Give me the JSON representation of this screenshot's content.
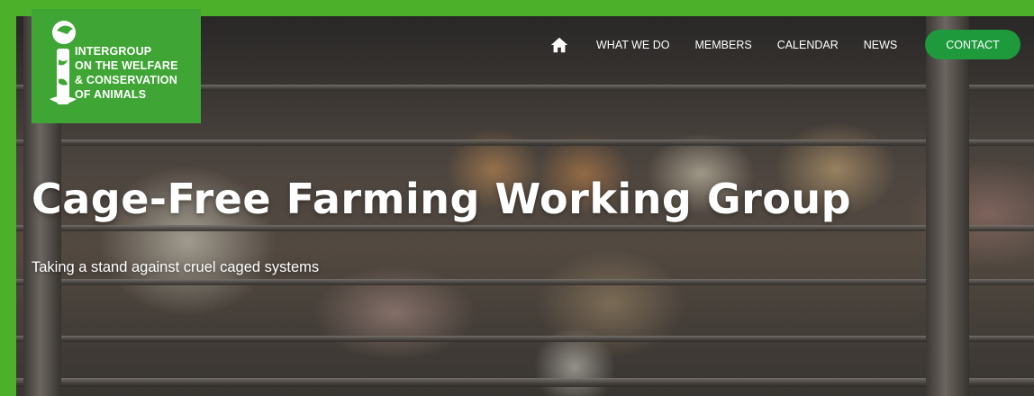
{
  "logo": {
    "lines": [
      "INTERGROUP",
      "ON THE WELFARE",
      "& CONSERVATION",
      "OF ANIMALS"
    ],
    "background": "#3fa535"
  },
  "nav": {
    "home_icon": "home-icon",
    "items": [
      {
        "label": "WHAT WE DO"
      },
      {
        "label": "MEMBERS"
      },
      {
        "label": "CALENDAR"
      },
      {
        "label": "NEWS"
      }
    ],
    "contact_label": "CONTACT"
  },
  "hero": {
    "title": "Cage-Free Farming Working Group",
    "subtitle": "Taking a stand against cruel caged systems"
  },
  "colors": {
    "frame_green": "#4db02b",
    "logo_green": "#3fa535",
    "button_green": "#1e9a3c",
    "text": "#ffffff"
  }
}
